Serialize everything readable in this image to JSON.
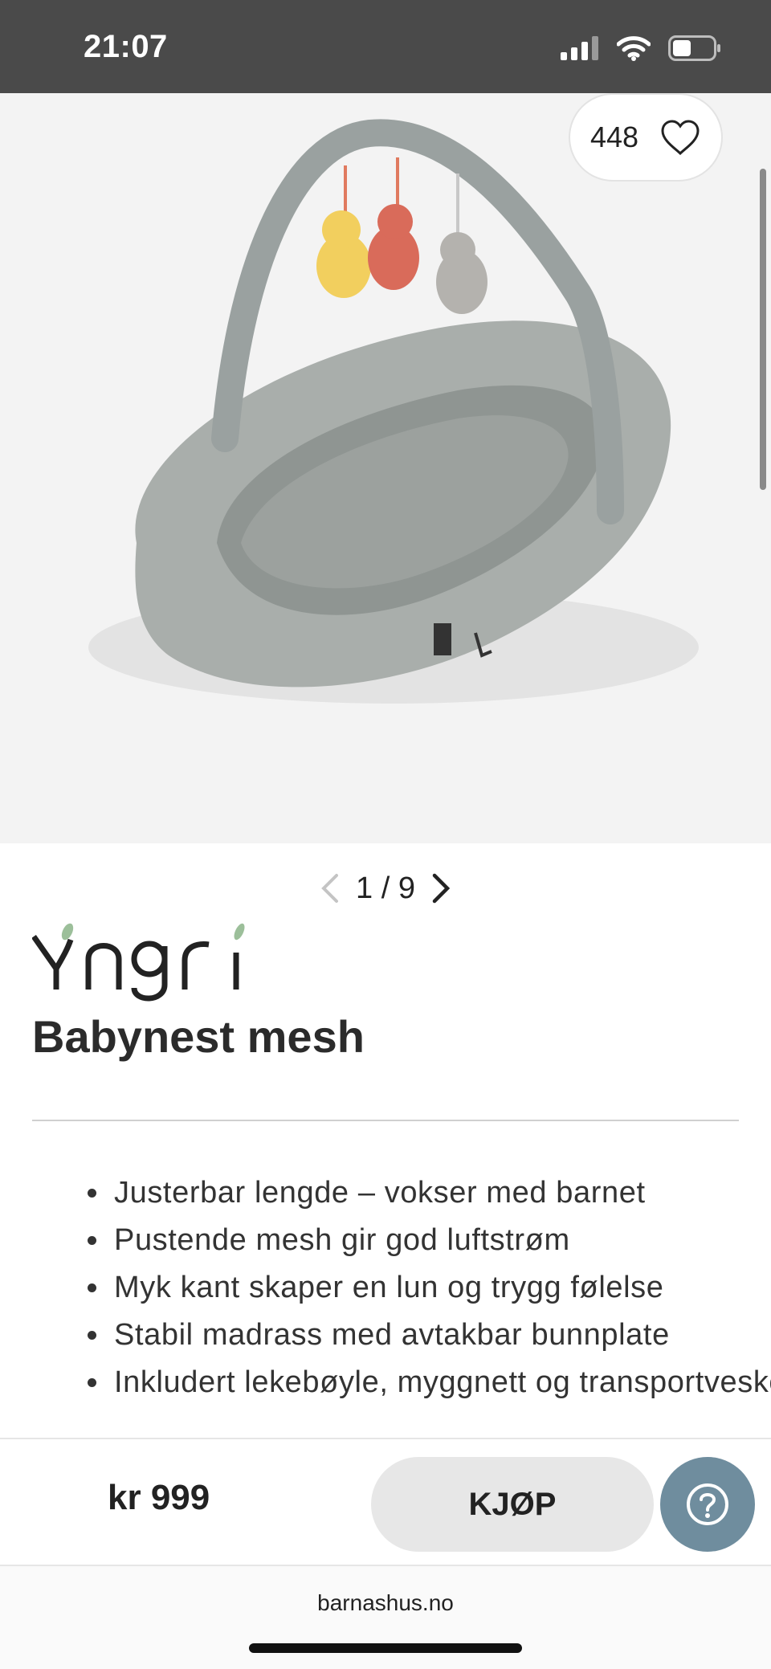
{
  "status_bar": {
    "time": "21:07"
  },
  "favorite": {
    "count": "448"
  },
  "gallery": {
    "page_indicator": "1 / 9"
  },
  "brand": {
    "logo_text": "Yngri"
  },
  "product": {
    "title": "Babynest mesh",
    "features": [
      "Justerbar lengde – vokser med barnet",
      "Pustende mesh gir god luftstrøm",
      "Myk kant skaper en lun og trygg følelse",
      "Stabil madrass med avtakbar bunnplate",
      "Inkludert lekebøyle, myggnett og transportveske"
    ]
  },
  "purchase": {
    "price": "kr 999",
    "buy_label": "KJØP"
  },
  "browser": {
    "url": "barnashus.no"
  },
  "colors": {
    "status_bar": "#4a4a4a",
    "help_button": "#6f8d9e",
    "buy_button": "#e7e7e7"
  }
}
